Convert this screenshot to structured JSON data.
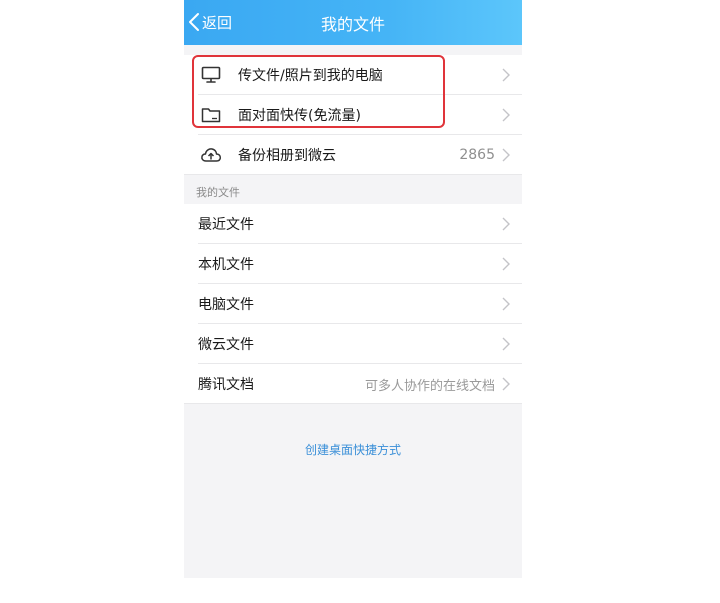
{
  "header": {
    "back_label": "返回",
    "title": "我的文件"
  },
  "top_group": [
    {
      "label": "传文件/照片到我的电脑",
      "icon": "monitor-icon"
    },
    {
      "label": "面对面快传(免流量)",
      "icon": "folder-icon"
    },
    {
      "label": "备份相册到微云",
      "icon": "cloud-upload-icon",
      "value": "2865"
    }
  ],
  "section": {
    "title": "我的文件"
  },
  "files_group": [
    {
      "label": "最近文件"
    },
    {
      "label": "本机文件"
    },
    {
      "label": "电脑文件"
    },
    {
      "label": "微云文件"
    },
    {
      "label": "腾讯文档",
      "value": "可多人协作的在线文档"
    }
  ],
  "footer": {
    "shortcut_label": "创建桌面快捷方式"
  },
  "colors": {
    "header_start": "#3aa8f2",
    "header_end": "#5cc6fb",
    "link": "#3a8fd8",
    "highlight": "#e0343a"
  }
}
